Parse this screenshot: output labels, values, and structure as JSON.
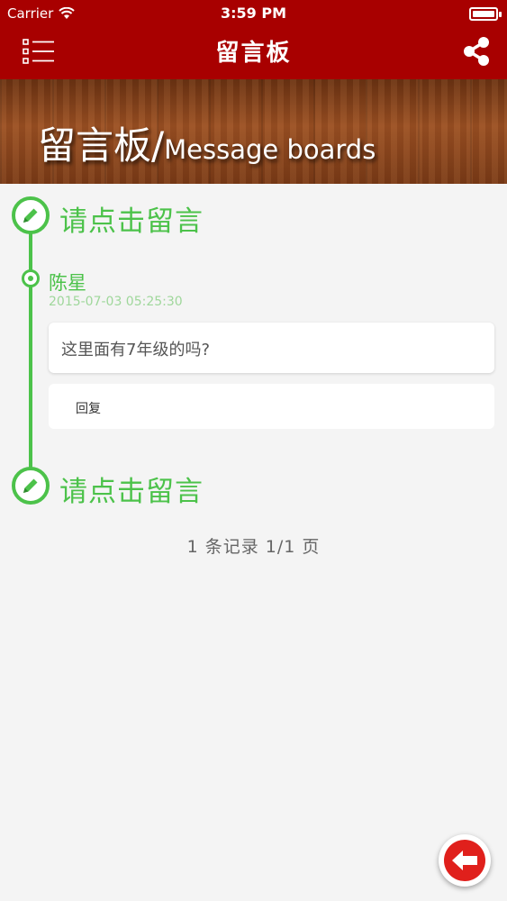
{
  "status_bar": {
    "carrier": "Carrier",
    "time": "3:59 PM",
    "battery_level": 1.0
  },
  "nav": {
    "title": "留言板",
    "menu_icon": "list-menu-icon",
    "share_icon": "share-icon"
  },
  "banner": {
    "title_zh": "留言板/",
    "title_en": "Message boards"
  },
  "timeline": {
    "leave_message_top": "请点击留言",
    "leave_message_bottom": "请点击留言",
    "entries": [
      {
        "author": "陈星",
        "timestamp": "2015-07-03 05:25:30",
        "content": "这里面有7年级的吗?",
        "reply_label": "回复"
      }
    ]
  },
  "pagination": {
    "text": "1 条记录 1/1 页"
  },
  "colors": {
    "nav_bg": "#a80000",
    "accent_green": "#4cc24a",
    "back_button_red": "#e0201c",
    "page_bg": "#f4f4f4"
  },
  "back_button": {
    "icon": "arrow-left-icon"
  }
}
